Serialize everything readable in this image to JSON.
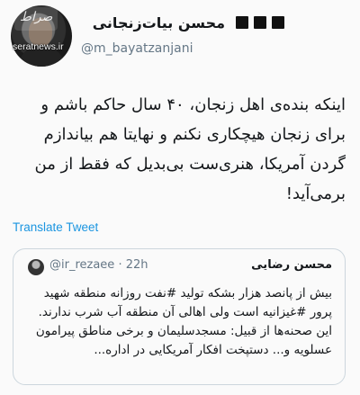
{
  "watermark": {
    "site": "seratnews.ir",
    "logo_text": "صراط"
  },
  "author": {
    "display_name": "محسن بیات‌زنجانی",
    "handle": "@m_bayatzanjani",
    "flags": [
      "black-flag",
      "black-flag",
      "black-flag"
    ]
  },
  "tweet": {
    "text": "اینکه بنده‌ی اهل زنجان، ۴۰ سال حاکم باشم و برای زنجان هیچکاری نکنم و نهایتا هم بیاندازم گردن آمریکا، هنری‌ست بی‌بدیل که فقط از من برمی‌آید!",
    "translate_label": "Translate Tweet"
  },
  "quoted": {
    "name": "محسن رضایی",
    "handle": "@ir_rezaee",
    "separator": "·",
    "time": "22h",
    "lines": [
      "بیش از پانصد هزار بشکه تولید #نفت روزانه منطقه شهید پرور #غیزانیه است ولی اهالی آن منطقه آب شرب ندارند.",
      "این صحنه‌ها از قبیل: مسجدسلیمان و برخی مناطق پیرامون عسلویه و... دستپخت افکار آمریکایی در اداره..."
    ]
  },
  "colors": {
    "link": "#1b95e0",
    "muted": "#657786",
    "border": "#ccd6dd"
  }
}
